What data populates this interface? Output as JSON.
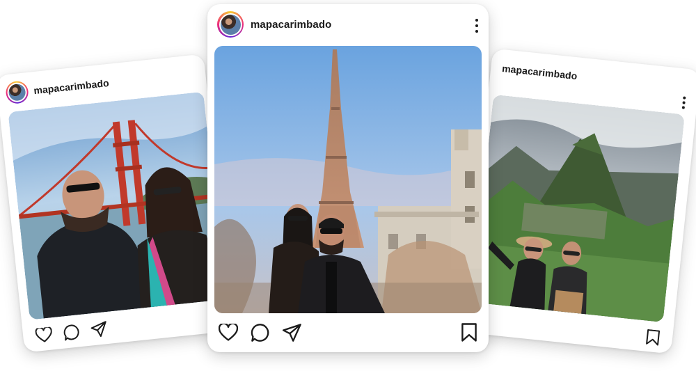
{
  "posts": [
    {
      "username": "mapacarimbado",
      "photo": "golden-gate-selfie",
      "icons": [
        "heart-icon",
        "comment-icon",
        "share-icon"
      ]
    },
    {
      "username": "mapacarimbado",
      "photo": "eiffel-tower-couple",
      "icons": [
        "heart-icon",
        "comment-icon",
        "share-icon",
        "bookmark-icon",
        "more-options-icon"
      ]
    },
    {
      "username": "mapacarimbado",
      "photo": "machu-picchu-couple",
      "icons": [
        "bookmark-icon",
        "more-options-icon"
      ]
    }
  ],
  "colors": {
    "avatar_ring": [
      "#f9ce34",
      "#ee2a7b",
      "#6228d7"
    ],
    "text": "#1b1b1b",
    "sky": "#7fb0e0"
  }
}
